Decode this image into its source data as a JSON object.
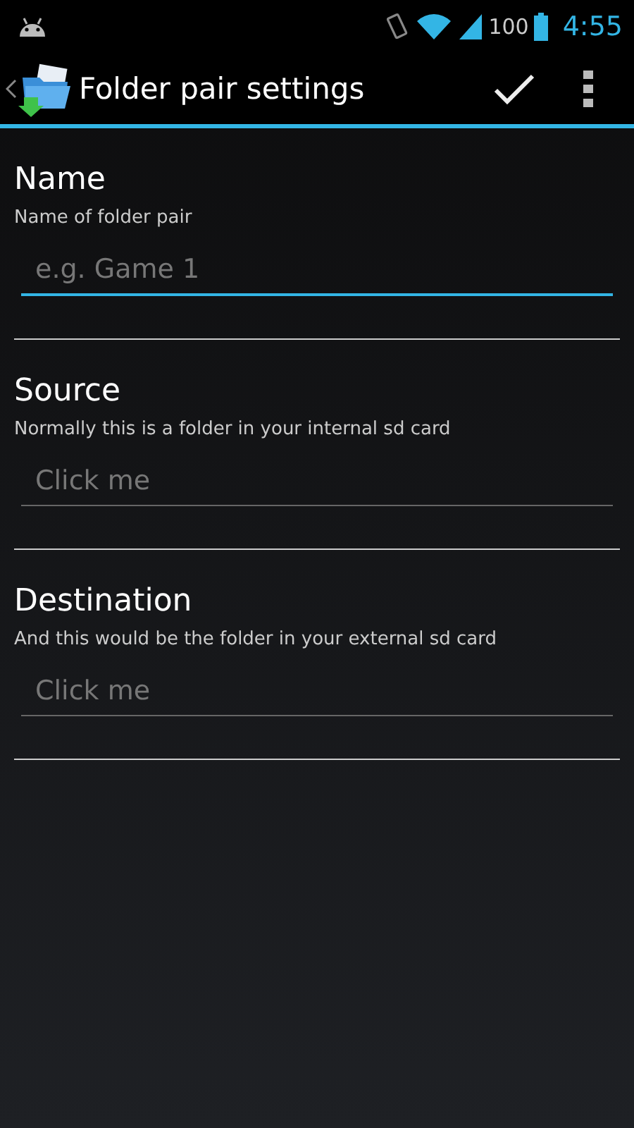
{
  "status_bar": {
    "battery": "100",
    "time": "4:55"
  },
  "action_bar": {
    "title": "Folder pair settings"
  },
  "sections": [
    {
      "title": "Name",
      "description": "Name of folder pair",
      "placeholder": "e.g. Game 1",
      "focused": true
    },
    {
      "title": "Source",
      "description": "Normally this is a folder in your internal sd card",
      "placeholder": "Click me",
      "focused": false
    },
    {
      "title": "Destination",
      "description": "And this would be the folder in your external sd card",
      "placeholder": "Click me",
      "focused": false
    }
  ]
}
